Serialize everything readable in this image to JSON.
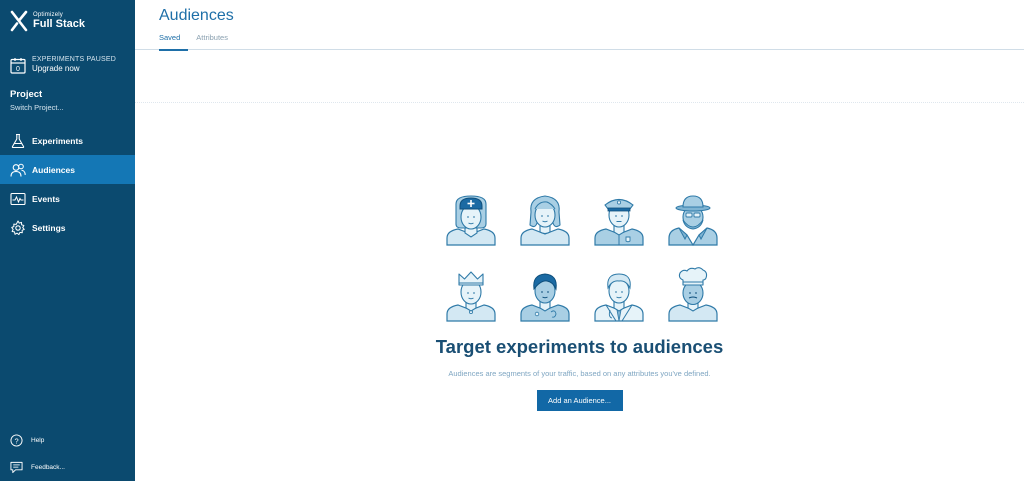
{
  "brand": {
    "line1": "Optimizely",
    "line2": "Full Stack"
  },
  "status": {
    "text": "EXPERIMENTS PAUSED",
    "upgrade": "Upgrade now"
  },
  "project": {
    "label": "Project",
    "switch": "Switch Project..."
  },
  "nav": [
    {
      "label": "Experiments",
      "icon": "flask-icon"
    },
    {
      "label": "Audiences",
      "icon": "people-icon",
      "active": true
    },
    {
      "label": "Events",
      "icon": "events-icon"
    },
    {
      "label": "Settings",
      "icon": "gear-icon"
    }
  ],
  "bottom_nav": [
    {
      "label": "Help",
      "icon": "help-icon"
    },
    {
      "label": "Feedback...",
      "icon": "feedback-icon"
    }
  ],
  "page": {
    "title": "Audiences",
    "tabs": [
      {
        "label": "Saved",
        "active": true
      },
      {
        "label": "Attributes"
      }
    ]
  },
  "empty_state": {
    "title": "Target experiments to audiences",
    "subtitle": "Audiences are segments of your traffic, based on any attributes you've defined.",
    "button": "Add an Audience..."
  },
  "avatars": [
    "nurse",
    "woman",
    "police-officer",
    "detective",
    "king",
    "student",
    "doctor",
    "chef"
  ],
  "colors": {
    "sidebar": "#0b4a6f",
    "active": "#1477b5",
    "accent": "#1e6fa8",
    "button": "#1268a6"
  }
}
